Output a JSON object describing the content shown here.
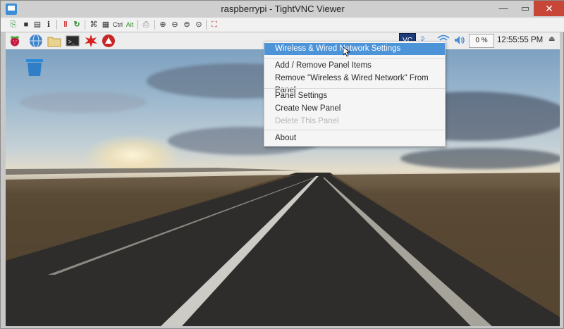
{
  "window": {
    "title": "raspberrypi - TightVNC Viewer",
    "min_glyph": "—",
    "max_glyph": "▭",
    "close_glyph": "✕"
  },
  "vnc_toolbar": {
    "ctrl_label": "Ctrl",
    "alt_label": "Alt"
  },
  "panel": {
    "vnc_label": "VC",
    "cpu_usage": "0 %",
    "clock": "12:55:55 PM"
  },
  "context_menu": {
    "items": [
      {
        "label": "Wireless & Wired Network Settings"
      },
      {
        "label": "Add / Remove Panel Items"
      },
      {
        "label": "Remove \"Wireless & Wired Network\" From Panel"
      },
      {
        "label": "Panel Settings"
      },
      {
        "label": "Create New Panel"
      },
      {
        "label": "Delete This Panel"
      },
      {
        "label": "About"
      }
    ]
  },
  "colors": {
    "menu_highlight": "#4d93d8",
    "close_button": "#c74638",
    "panel_background": "#ededed"
  }
}
